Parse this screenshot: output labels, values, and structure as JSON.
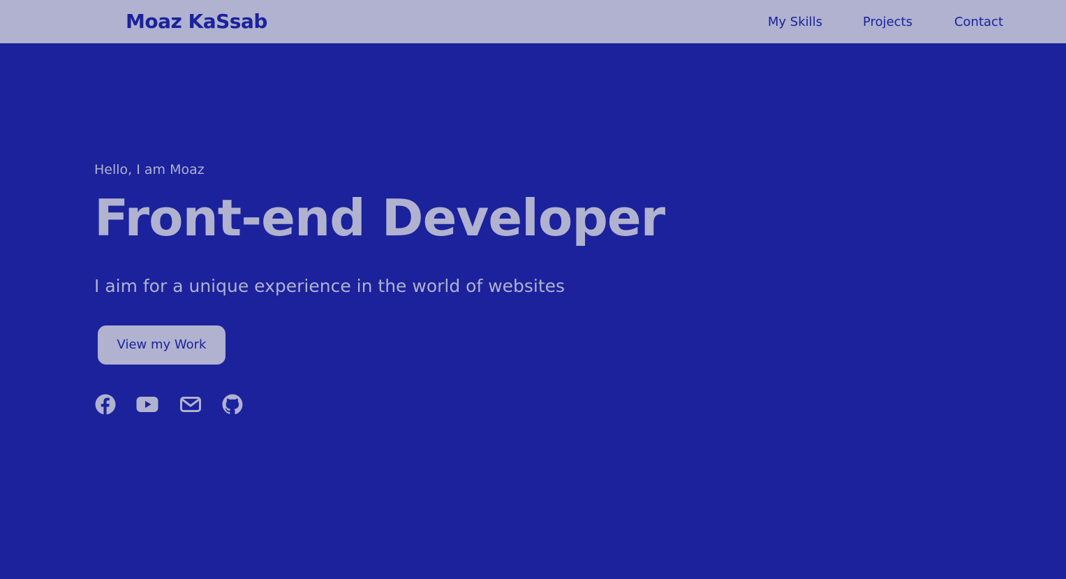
{
  "header": {
    "brand": "Moaz KaSsab",
    "nav": [
      {
        "label": "My Skills"
      },
      {
        "label": "Projects"
      },
      {
        "label": "Contact"
      }
    ]
  },
  "hero": {
    "greeting": "Hello, I am Moaz",
    "headline": "Front-end Developer",
    "tagline": "I aim for a unique experience in the world of websites",
    "cta_label": "View my Work"
  },
  "socials": [
    {
      "icon": "facebook-icon"
    },
    {
      "icon": "youtube-icon"
    },
    {
      "icon": "mail-icon"
    },
    {
      "icon": "github-icon"
    }
  ],
  "colors": {
    "background": "#1b229b",
    "accent": "#b0b2d0"
  }
}
